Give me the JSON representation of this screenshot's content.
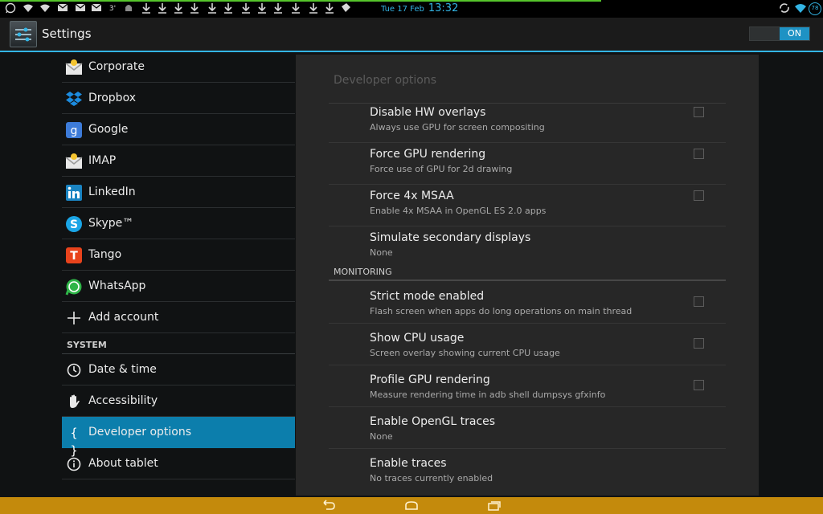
{
  "status_bar": {
    "date": "Tue 17 Feb",
    "time": "13:32",
    "left_icons": [
      "whatsapp-icon",
      "wifi-question-icon",
      "wifi-icon",
      "gmail-icon",
      "gmail-icon",
      "gmail-icon",
      "number-three-icon",
      "android-icon",
      "download-icon",
      "download-icon",
      "download-icon",
      "download-icon",
      "download-icon",
      "download-icon",
      "download-icon",
      "download-icon",
      "download-icon",
      "download-icon",
      "download-icon",
      "download-icon",
      "store-bag-icon"
    ],
    "battery_level": "78",
    "right_icons": [
      "sync-icon",
      "wifi-icon",
      "battery-icon"
    ]
  },
  "action_bar": {
    "title": "Settings",
    "switch_label": "ON"
  },
  "sidebar": {
    "accounts": [
      {
        "label": "Corporate",
        "icon": "email-icon"
      },
      {
        "label": "Dropbox",
        "icon": "dropbox-icon"
      },
      {
        "label": "Google",
        "icon": "google-icon"
      },
      {
        "label": "IMAP",
        "icon": "email-icon"
      },
      {
        "label": "LinkedIn",
        "icon": "linkedin-icon"
      },
      {
        "label": "Skype™",
        "icon": "skype-icon"
      },
      {
        "label": "Tango",
        "icon": "tango-icon"
      },
      {
        "label": "WhatsApp",
        "icon": "whatsapp-icon"
      },
      {
        "label": "Add account",
        "icon": "plus-icon"
      }
    ],
    "system_header": "SYSTEM",
    "system": [
      {
        "label": "Date & time",
        "icon": "clock-icon"
      },
      {
        "label": "Accessibility",
        "icon": "hand-icon"
      },
      {
        "label": "Developer options",
        "icon": "braces-icon",
        "selected": true
      },
      {
        "label": "About tablet",
        "icon": "info-icon"
      }
    ]
  },
  "panel": {
    "title": "Developer options",
    "drawing_items": [
      {
        "title": "Disable HW overlays",
        "summary": "Always use GPU for screen compositing",
        "checkbox": true
      },
      {
        "title": "Force GPU rendering",
        "summary": "Force use of GPU for 2d drawing",
        "checkbox": true
      },
      {
        "title": "Force 4x MSAA",
        "summary": "Enable 4x MSAA in OpenGL ES 2.0 apps",
        "checkbox": true
      },
      {
        "title": "Simulate secondary displays",
        "summary": "None",
        "checkbox": false
      }
    ],
    "monitoring_header": "MONITORING",
    "monitoring_items": [
      {
        "title": "Strict mode enabled",
        "summary": "Flash screen when apps do long operations on main thread",
        "checkbox": true
      },
      {
        "title": "Show CPU usage",
        "summary": "Screen overlay showing current CPU usage",
        "checkbox": true
      },
      {
        "title": "Profile GPU rendering",
        "summary": "Measure rendering time in adb shell dumpsys gfxinfo",
        "checkbox": true
      },
      {
        "title": "Enable OpenGL traces",
        "summary": "None",
        "checkbox": false
      },
      {
        "title": "Enable traces",
        "summary": "No traces currently enabled",
        "checkbox": false
      }
    ]
  },
  "nav_bar": {
    "buttons": [
      "back-icon",
      "home-icon",
      "recent-apps-icon"
    ]
  },
  "colors": {
    "accent": "#33b5e5",
    "selected": "#0c7eac",
    "nav_bar": "#c48a0c",
    "progress": "#55c52b"
  }
}
